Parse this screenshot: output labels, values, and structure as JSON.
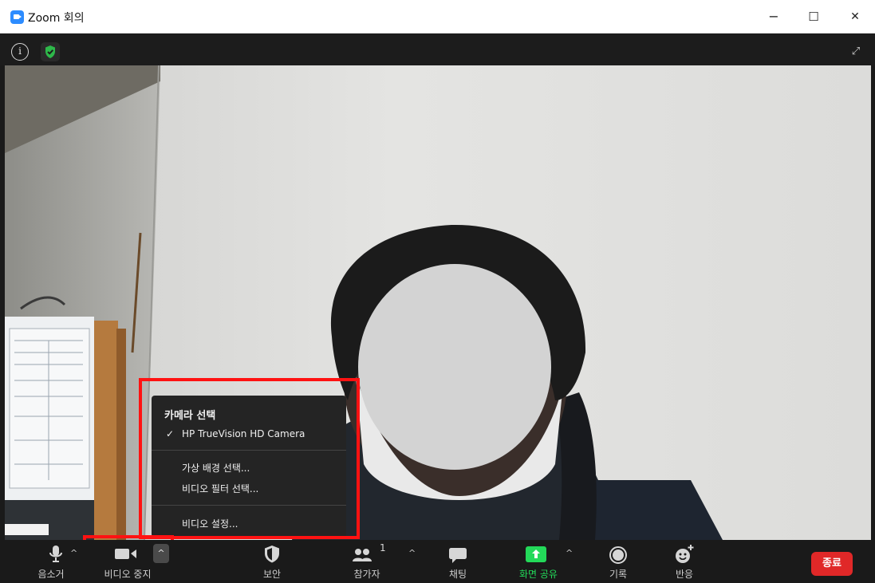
{
  "window": {
    "title": "Zoom 회의",
    "minimize_glyph": "−",
    "maximize_glyph": "☐",
    "close_glyph": "✕"
  },
  "topbar": {
    "info_glyph": "i",
    "expand_glyph": "⤢"
  },
  "camera_menu": {
    "heading": "카메라 선택",
    "check_glyph": "✓",
    "camera_item": "HP TrueVision HD Camera",
    "virtual_bg_item": "가상 배경 선택...",
    "video_filter_item": "비디오 필터 선택...",
    "video_settings_item": "비디오 설정..."
  },
  "toolbar": {
    "mute_label": "음소거",
    "stop_video_label": "비디오 중지",
    "security_label": "보안",
    "participants_label": "참가자",
    "participants_count": "1",
    "chat_label": "채팅",
    "share_screen_label": "화면 공유",
    "record_label": "기록",
    "reactions_label": "반응",
    "end_label": "종료",
    "caret_glyph": "^"
  },
  "colors": {
    "accent": "#2D8CFF",
    "share_green": "#23D959",
    "end_red": "#E02828",
    "highlight_red": "#FF1212",
    "shield_green": "#2EB84A"
  }
}
